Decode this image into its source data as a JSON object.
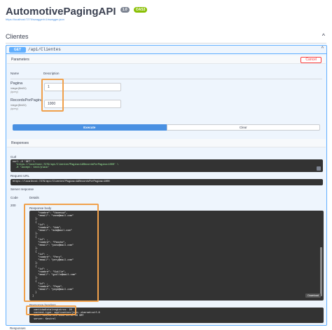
{
  "header": {
    "title": "AutomotivePagingAPI",
    "version_badge": "1.0",
    "oas_badge": "OAS3",
    "spec_link": "https://localhost:7279/swagger/v1/swagger.json"
  },
  "tag": {
    "name": "Clientes",
    "chevron": "^"
  },
  "operation": {
    "method": "GET",
    "path": "/api/Clientes",
    "chevron": "^"
  },
  "parameters": {
    "section_title": "Parameters",
    "cancel_label": "Cancel",
    "col_name": "Name",
    "col_description": "Description",
    "items": [
      {
        "name": "Pagina",
        "type": "integer($int32)",
        "in": "(query)",
        "value": "1"
      },
      {
        "name": "RecordsPorPagina",
        "type": "integer($int32)",
        "in": "(query)",
        "value": "1000"
      }
    ]
  },
  "buttons": {
    "execute": "Execute",
    "clear": "Clear"
  },
  "responses": {
    "section_title": "Responses",
    "curl_label": "Curl",
    "curl_lines": [
      "curl -X 'GET' \\",
      "  'https://localhost:7279/api/Clientes?Pagina=1&RecordsPorPagina=1000' \\",
      "  -H 'accept: text/plain'"
    ],
    "request_url_label": "Request URL",
    "request_url": "https://localhost:7279/api/Clientes?Pagina=1&RecordsPorPagina=1000",
    "server_response_label": "Server response",
    "code_col": "Code",
    "details_col": "Details",
    "status_code": "200",
    "body_label": "Response body",
    "body_lines": [
      "    \"nombre\": \"Vanessa\",",
      "    \"email\": \"vane@mail.com\"",
      "  },",
      "  {",
      "    \"id\": ,",
      "    \"nombre\": \"Ada\",",
      "    \"email\": \"ada@mail.com\"",
      "  },",
      "  {",
      "    \"id\": ,",
      "    \"nombre\": \"Pancho\",",
      "    \"email\": \"panc@mail.com\"",
      "  },",
      "  {",
      "    \"id\": ,",
      "    \"nombre\": \"Pery\",",
      "    \"email\": \"pery@mail.com\"",
      "  },",
      "  {",
      "    \"id\": ,",
      "    \"nombre\": \"Guille\",",
      "    \"email\": \"guille@mail.com\"",
      "  },",
      "  {",
      "    \"id\": ,",
      "    \"nombre\": \"Pepe\",",
      "    \"email\": \"pepe@mail.com\"",
      "  }",
      "]"
    ],
    "download_label": "Download",
    "headers_label": "Response headers",
    "header_lines": [
      " cantidadtotalregistros: 20",
      " content-type: application/json; charset=utf-8",
      " date: Mon,24 Oct 2022 00:37:46 GMT",
      " server: Kestrel"
    ],
    "bottom_label": "Responses"
  },
  "colors": {
    "get_blue": "#61affe",
    "execute_blue": "#4990e2",
    "highlight_orange": "#f0a04b",
    "cancel_red": "#f93e3e",
    "code_bg": "#333333"
  }
}
